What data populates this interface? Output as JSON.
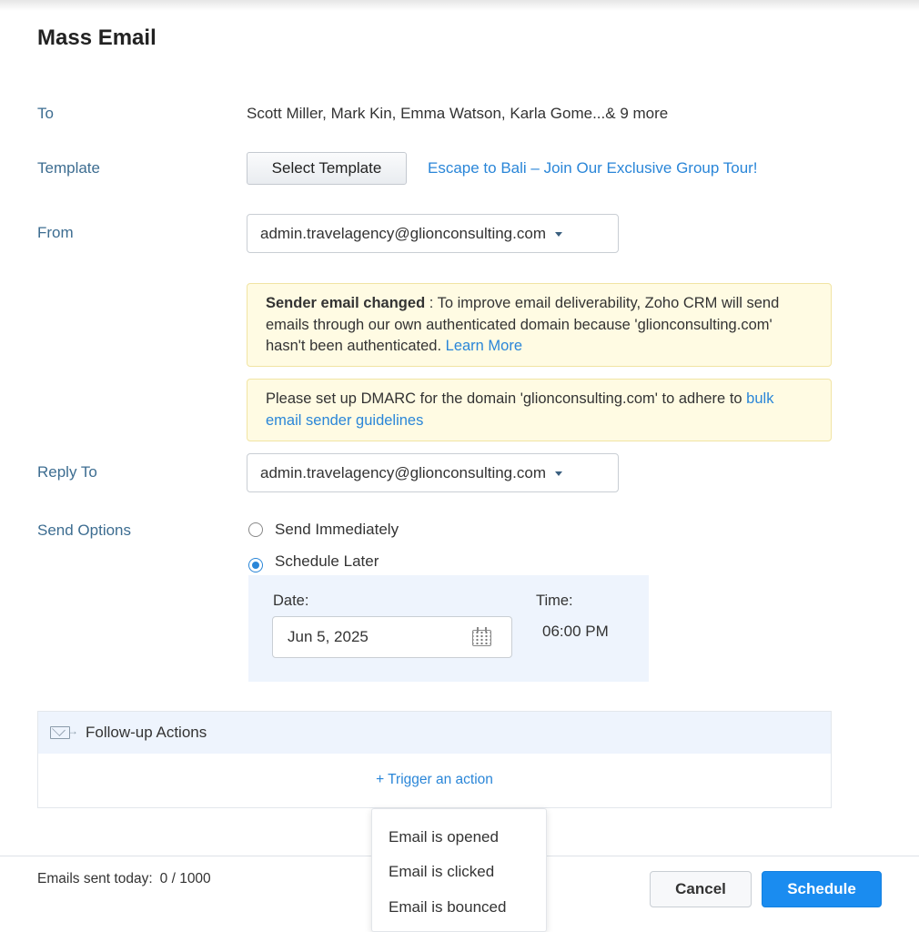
{
  "dialog": {
    "title": "Mass Email"
  },
  "to": {
    "label": "To",
    "value": "Scott Miller, Mark Kin, Emma Watson, Karla Gome...& 9 more"
  },
  "template": {
    "label": "Template",
    "select_button": "Select Template",
    "selected_name": "Escape to Bali – Join Our Exclusive Group Tour!"
  },
  "from": {
    "label": "From",
    "value": "admin.travelagency@glionconsulting.com"
  },
  "notices": {
    "sender_changed": {
      "title": "Sender email changed",
      "text": " : To improve email deliverability, Zoho CRM will send emails through our own authenticated domain because 'glionconsulting.com' hasn't been authenticated. ",
      "link": "Learn More"
    },
    "dmarc": {
      "text": "Please set up DMARC for the domain 'glionconsulting.com' to adhere to ",
      "link": "bulk email sender guidelines"
    }
  },
  "reply_to": {
    "label": "Reply To",
    "value": "admin.travelagency@glionconsulting.com"
  },
  "send_options": {
    "label": "Send Options",
    "immediately": "Send Immediately",
    "later": "Schedule Later",
    "selected": "later",
    "date_label": "Date:",
    "date_value": "Jun 5, 2025",
    "time_label": "Time:",
    "time_value": "06:00 PM"
  },
  "followup": {
    "title": "Follow-up Actions",
    "trigger_link": "+ Trigger an action",
    "menu": [
      "Email is opened",
      "Email is clicked",
      "Email is bounced"
    ]
  },
  "footer": {
    "emails_sent_label": "Emails sent today:",
    "emails_sent_count": "0 / 1000",
    "cancel": "Cancel",
    "schedule": "Schedule"
  },
  "colors": {
    "label": "#3d6d91",
    "link": "#2a86d8",
    "primary": "#1a8cf0",
    "notice_bg": "#fffbe3",
    "panel_bg": "#eef4fd"
  }
}
